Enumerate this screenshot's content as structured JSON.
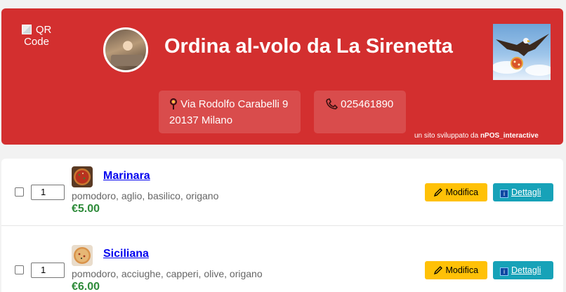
{
  "header": {
    "qr_alt": "QR Code",
    "title": "Ordina al-volo da La Sirenetta",
    "address_line1": "Via Rodolfo Carabelli 9",
    "address_line2": "20137 Milano",
    "phone": "025461890",
    "credit_prefix": "un sito sviluppato da",
    "credit_brand": "nPOS_interactive",
    "accent_color": "#d32f2f"
  },
  "menu": {
    "items": [
      {
        "quantity": "1",
        "name": "Marinara",
        "description": "pomodoro, aglio, basilico, origano",
        "price": "€5.00",
        "modify_label": "Modifica",
        "details_label": "Dettagli"
      },
      {
        "quantity": "1",
        "name": "Siciliana",
        "description": "pomodoro, acciughe, capperi, olive, origano",
        "price": "€6.00",
        "modify_label": "Modifica",
        "details_label": "Dettagli"
      }
    ]
  },
  "colors": {
    "price": "#2e8b3a",
    "modify_button": "#ffc107",
    "details_button": "#17a2b8"
  }
}
